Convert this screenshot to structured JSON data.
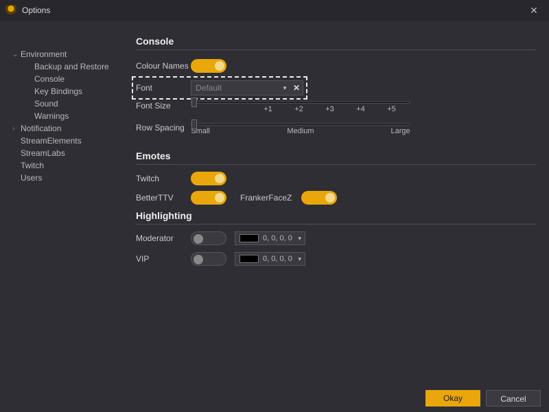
{
  "window": {
    "title": "Options"
  },
  "sidebar": {
    "items": [
      {
        "label": "Environment",
        "expanded": true,
        "children": [
          {
            "label": "Backup and Restore"
          },
          {
            "label": "Console"
          },
          {
            "label": "Key Bindings"
          },
          {
            "label": "Sound"
          },
          {
            "label": "Warnings"
          }
        ]
      },
      {
        "label": "Notification",
        "expanded": false
      },
      {
        "label": "StreamElements"
      },
      {
        "label": "StreamLabs"
      },
      {
        "label": "Twitch"
      },
      {
        "label": "Users"
      }
    ]
  },
  "sections": {
    "console": {
      "title": "Console",
      "colour_names": {
        "label": "Colour Names",
        "on": true
      },
      "font": {
        "label": "Font",
        "value": "Default"
      },
      "font_size": {
        "label": "Font Size",
        "ticks": [
          "",
          "",
          "+1",
          "+2",
          "+3",
          "+4",
          "+5"
        ],
        "thumb_pos": 0
      },
      "row_spacing": {
        "label": "Row Spacing",
        "ticks": [
          "Small",
          "Medium",
          "Large"
        ],
        "thumb_pos": 0
      }
    },
    "emotes": {
      "title": "Emotes",
      "twitch": {
        "label": "Twitch",
        "on": true
      },
      "betterttv": {
        "label": "BetterTTV",
        "on": true
      },
      "frankerfacez": {
        "label": "FrankerFaceZ",
        "on": true
      }
    },
    "highlighting": {
      "title": "Highlighting",
      "moderator": {
        "label": "Moderator",
        "on": false,
        "color": "0, 0, 0, 0"
      },
      "vip": {
        "label": "VIP",
        "on": false,
        "color": "0, 0, 0, 0"
      }
    }
  },
  "footer": {
    "okay": "Okay",
    "cancel": "Cancel"
  },
  "colors": {
    "accent": "#e9a70b"
  }
}
